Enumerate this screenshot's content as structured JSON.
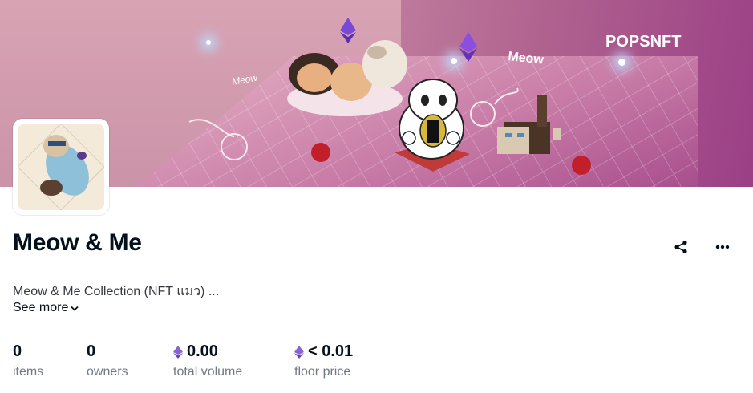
{
  "banner": {
    "brand": "POPSNFT",
    "doodle_text_left": "Meow",
    "doodle_text_right": "Meow"
  },
  "collection": {
    "title": "Meow & Me",
    "description": "Meow & Me Collection (NFT แมว) ...",
    "see_more_label": "See more"
  },
  "actions": {
    "share_icon": "share-icon",
    "more_icon": "more-icon"
  },
  "stats": [
    {
      "value": "0",
      "label": "items",
      "eth": false
    },
    {
      "value": "0",
      "label": "owners",
      "eth": false
    },
    {
      "value": "0.00",
      "label": "total volume",
      "eth": true
    },
    {
      "value": "< 0.01",
      "label": "floor price",
      "eth": true
    }
  ],
  "colors": {
    "text_primary": "#04111d",
    "text_secondary": "#707a83",
    "eth_purple": "#7b5fc8"
  }
}
